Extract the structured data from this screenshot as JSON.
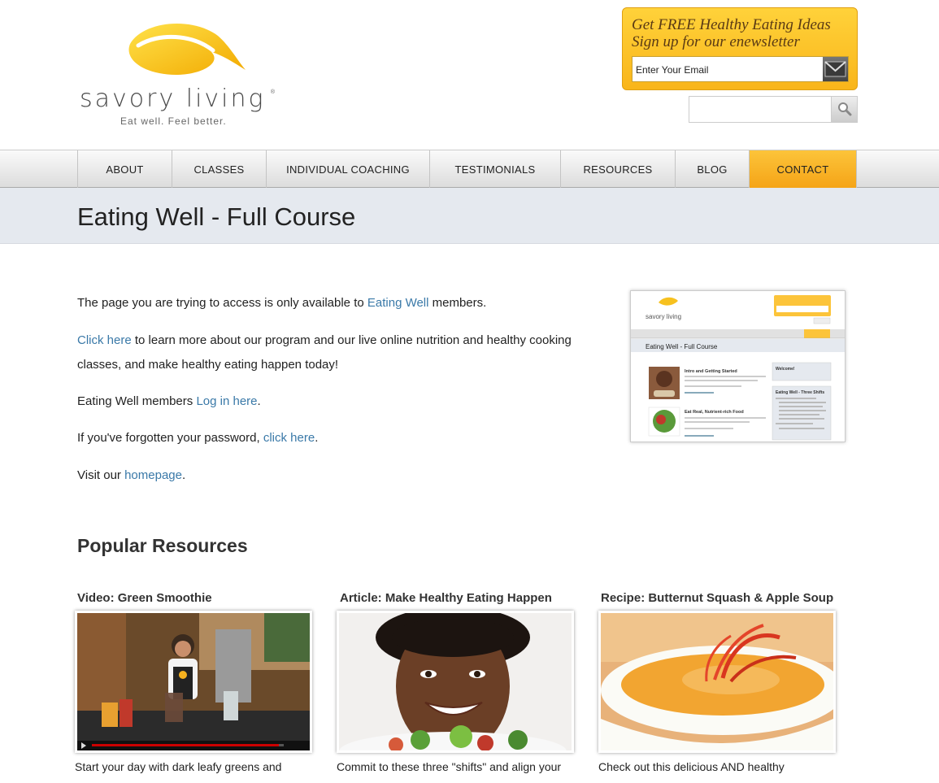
{
  "logo": {
    "name": "savory living",
    "tagline": "Eat well. Feel better.",
    "reg": "®"
  },
  "newsletter": {
    "title_line1": "Get FREE Healthy Eating Ideas",
    "title_line2": "Sign up for our enewsletter",
    "email_placeholder": "Enter Your Email"
  },
  "search": {
    "placeholder": ""
  },
  "nav": {
    "items": [
      {
        "label": "ABOUT"
      },
      {
        "label": "CLASSES"
      },
      {
        "label": "INDIVIDUAL COACHING"
      },
      {
        "label": "TESTIMONIALS"
      },
      {
        "label": "RESOURCES"
      },
      {
        "label": "BLOG"
      },
      {
        "label": "CONTACT"
      }
    ],
    "active": "CONTACT"
  },
  "page": {
    "title": "Eating Well - Full Course"
  },
  "content": {
    "p1_before": "The page you are trying to access is only available to ",
    "p1_link": "Eating Well",
    "p1_after": " members.",
    "p2_link": "Click here",
    "p2_after": " to learn more about our program and our live online nutrition and healthy cooking classes, and make healthy eating happen today!",
    "p3_before": "Eating Well members ",
    "p3_link": "Log in here",
    "p3_after": ".",
    "p4_before": "If you've forgotten your password, ",
    "p4_link": "click here",
    "p4_after": ".",
    "p5_before": "Visit our ",
    "p5_link": "homepage",
    "p5_after": "."
  },
  "preview": {
    "title": "Eating Well - Full Course",
    "item1": "Intro and Getting Started",
    "item2": "Eat Real, Nutrient-rich Food",
    "welcome": "Welcome!",
    "shifts": "Eating Well - Three Shifts"
  },
  "resources": {
    "title": "Popular Resources",
    "items": [
      {
        "title": "Video: Green Smoothie",
        "desc": "Start your day with dark leafy greens and"
      },
      {
        "title": "Article: Make Healthy Eating Happen",
        "desc": "Commit to these three \"shifts\" and align your"
      },
      {
        "title": "Recipe: Butternut Squash & Apple Soup",
        "desc": "Check out this delicious AND healthy"
      }
    ]
  },
  "colors": {
    "accent": "#f7b21f",
    "link": "#3a79a8",
    "title_band": "#e5e9ef"
  }
}
